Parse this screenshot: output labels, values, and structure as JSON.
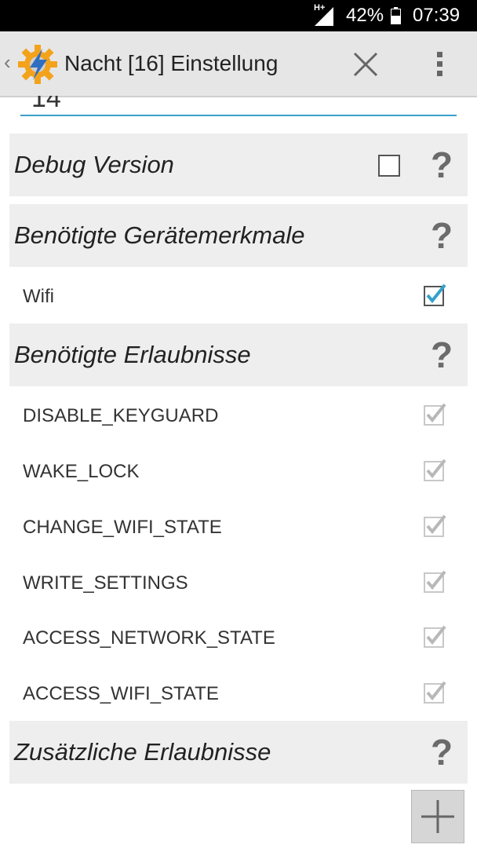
{
  "status_bar": {
    "network": "H+",
    "battery": "42%",
    "time": "07:39"
  },
  "action_bar": {
    "title": "Nacht [16] Einstellung",
    "back_icon": "chevron-left-icon",
    "app_icon": "tasker-gear-lightning-icon",
    "close_icon": "close-icon",
    "menu_icon": "overflow-menu-icon"
  },
  "previous_field": {
    "value": "14"
  },
  "sections": {
    "debug": {
      "title": "Debug Version",
      "checked": false
    },
    "features": {
      "title": "Benötigte Gerätemerkmale",
      "items": [
        {
          "label": "Wifi",
          "checked": true,
          "enabled": true
        }
      ]
    },
    "permissions": {
      "title": "Benötigte Erlaubnisse",
      "items": [
        {
          "label": "DISABLE_KEYGUARD",
          "checked": true,
          "enabled": false
        },
        {
          "label": "WAKE_LOCK",
          "checked": true,
          "enabled": false
        },
        {
          "label": "CHANGE_WIFI_STATE",
          "checked": true,
          "enabled": false
        },
        {
          "label": "WRITE_SETTINGS",
          "checked": true,
          "enabled": false
        },
        {
          "label": "ACCESS_NETWORK_STATE",
          "checked": true,
          "enabled": false
        },
        {
          "label": "ACCESS_WIFI_STATE",
          "checked": true,
          "enabled": false
        }
      ]
    },
    "additional": {
      "title": "Zusätzliche Erlaubnisse"
    }
  },
  "help_glyph": "?",
  "add_button_icon": "plus-icon",
  "colors": {
    "accent": "#3aa0c8",
    "check_enabled": "#33a1c9",
    "check_disabled": "#b8b8b8",
    "header_bg": "#eeeeee",
    "actionbar_bg": "#e6e6e6"
  }
}
